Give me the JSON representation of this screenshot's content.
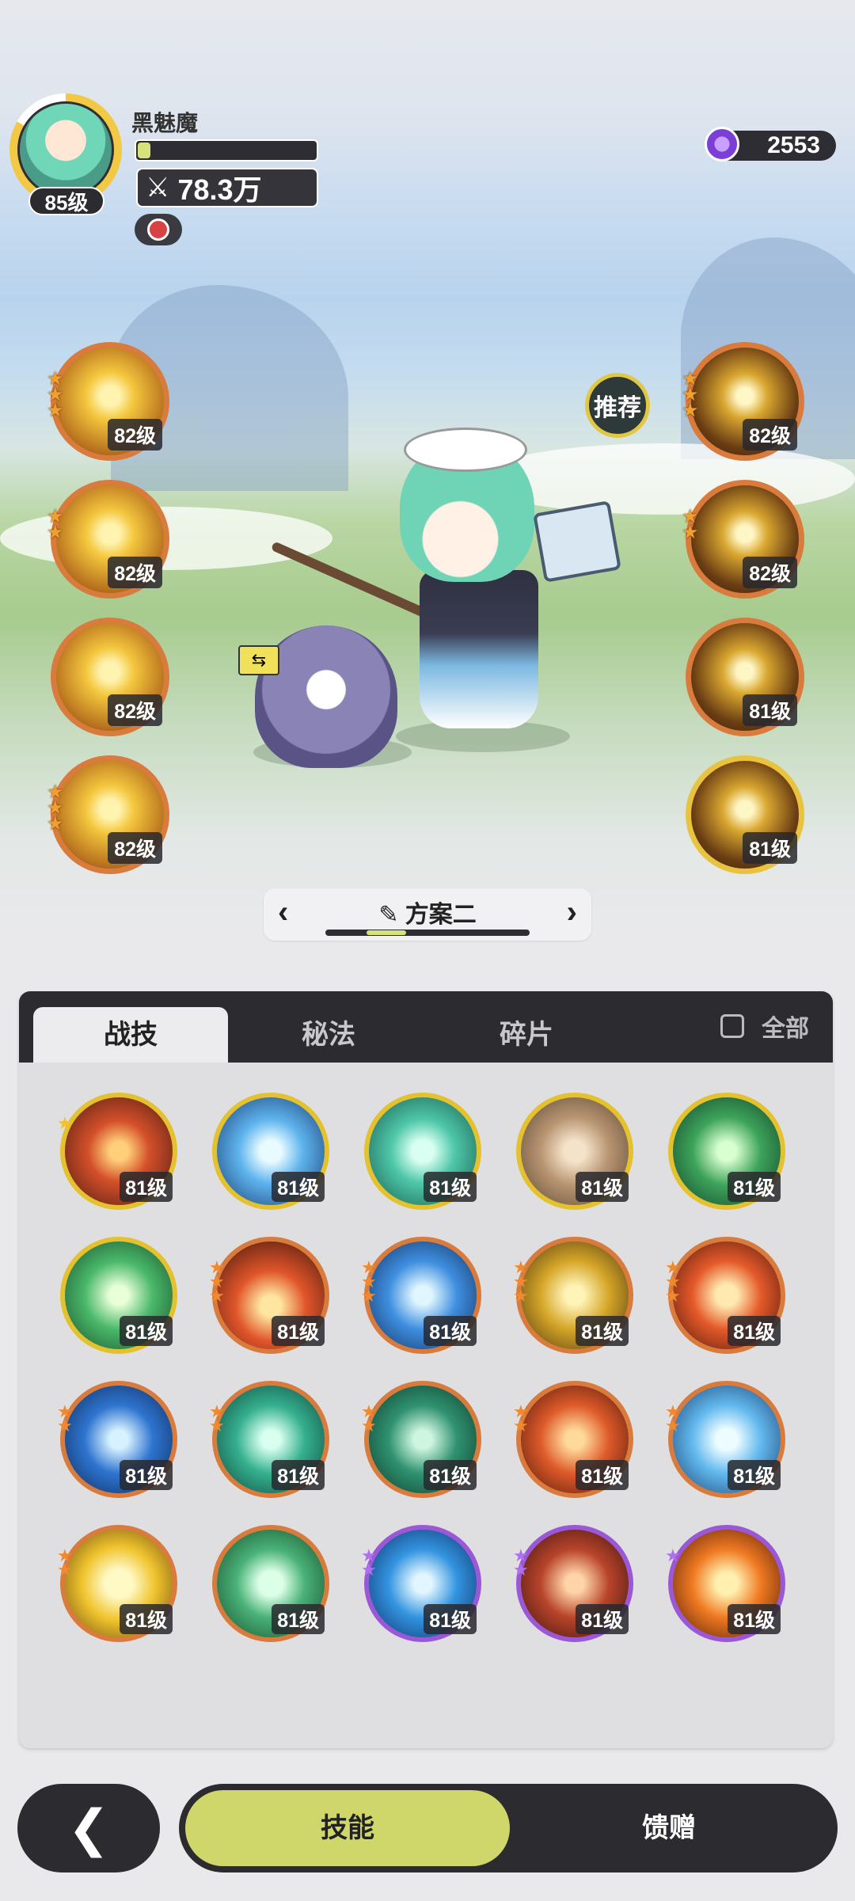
{
  "player": {
    "name": "黑魅魔",
    "level": "85级",
    "power": "78.3万",
    "exp_fraction": 0.07
  },
  "currency": {
    "amount": "2553",
    "icon": "purple-gem-icon"
  },
  "equipped_left": [
    {
      "level": "82级",
      "stars": 3,
      "icon": "lightning-burst-icon"
    },
    {
      "level": "82级",
      "stars": 2,
      "icon": "golden-explosion-icon"
    },
    {
      "level": "82级",
      "stars": 0,
      "icon": "golden-orb-icon"
    },
    {
      "level": "82级",
      "stars": 3,
      "icon": "golden-slash-icon"
    }
  ],
  "equipped_right": [
    {
      "level": "82级",
      "stars": 3,
      "icon": "golden-burst-icon"
    },
    {
      "level": "82级",
      "stars": 2,
      "icon": "golden-wings-icon"
    },
    {
      "level": "81级",
      "stars": 0,
      "icon": "golden-comet-icon"
    },
    {
      "level": "81级",
      "stars": 0,
      "icon": "golden-shield-icon"
    }
  ],
  "recommend_label": "推荐",
  "loadout": {
    "name": "方案二",
    "position_fraction": 0.2
  },
  "tabs": [
    {
      "label": "战技",
      "active": true
    },
    {
      "label": "秘法",
      "active": false
    },
    {
      "label": "碎片",
      "active": false
    }
  ],
  "all_toggle": {
    "label": "全部",
    "checked": false
  },
  "skills": [
    {
      "level": "81级",
      "ring": "gold",
      "stars": 1,
      "star_color": "gold",
      "icon": "fire-swirl-icon"
    },
    {
      "level": "81级",
      "ring": "gold",
      "stars": 0,
      "star_color": "gold",
      "icon": "ice-shatter-icon"
    },
    {
      "level": "81级",
      "ring": "gold",
      "stars": 0,
      "star_color": "gold",
      "icon": "wind-vortex-icon"
    },
    {
      "level": "81级",
      "ring": "gold",
      "stars": 0,
      "star_color": "gold",
      "icon": "rock-shield-icon"
    },
    {
      "level": "81级",
      "ring": "gold",
      "stars": 0,
      "star_color": "gold",
      "icon": "healing-cross-icon"
    },
    {
      "level": "81级",
      "ring": "gold",
      "stars": 0,
      "star_color": "gold",
      "icon": "green-slash-icon"
    },
    {
      "level": "81级",
      "ring": "orange",
      "stars": 3,
      "star_color": "orange",
      "icon": "fireball-icon"
    },
    {
      "level": "81级",
      "ring": "orange",
      "stars": 3,
      "star_color": "orange",
      "icon": "ice-shard-icon"
    },
    {
      "level": "81级",
      "ring": "orange",
      "stars": 3,
      "star_color": "orange",
      "icon": "golden-spikes-icon"
    },
    {
      "level": "81级",
      "ring": "orange",
      "stars": 3,
      "star_color": "orange",
      "icon": "fire-orb-icon"
    },
    {
      "level": "81级",
      "ring": "orange",
      "stars": 2,
      "star_color": "orange",
      "icon": "blue-flame-icon"
    },
    {
      "level": "81级",
      "ring": "orange",
      "stars": 2,
      "star_color": "orange",
      "icon": "wind-blade-icon"
    },
    {
      "level": "81级",
      "ring": "orange",
      "stars": 2,
      "star_color": "orange",
      "icon": "thorn-vine-icon"
    },
    {
      "level": "81级",
      "ring": "orange",
      "stars": 2,
      "star_color": "orange",
      "icon": "lava-burst-icon"
    },
    {
      "level": "81级",
      "ring": "orange",
      "stars": 2,
      "star_color": "orange",
      "icon": "ice-crystal-icon"
    },
    {
      "level": "81级",
      "ring": "orange",
      "stars": 2,
      "star_color": "orange",
      "icon": "golden-sun-icon"
    },
    {
      "level": "81级",
      "ring": "orange",
      "stars": 0,
      "star_color": "orange",
      "icon": "wind-sphere-icon"
    },
    {
      "level": "81级",
      "ring": "purple",
      "stars": 2,
      "star_color": "purple",
      "icon": "water-vortex-icon"
    },
    {
      "level": "81级",
      "ring": "purple",
      "stars": 2,
      "star_color": "purple",
      "icon": "meteor-icon"
    },
    {
      "level": "81级",
      "ring": "purple",
      "stars": 1,
      "star_color": "purple",
      "icon": "fire-burst-icon"
    }
  ],
  "bottom_nav": {
    "back": "back-arrow-icon",
    "tabs": [
      {
        "label": "技能",
        "active": true
      },
      {
        "label": "馈赠",
        "active": false
      }
    ]
  },
  "colors": {
    "accent": "#cfd66a",
    "panel_dark": "#2b2b30",
    "ring_gold": "#e4c12e",
    "ring_orange": "#d87b3c",
    "ring_purple": "#9b58d6"
  }
}
